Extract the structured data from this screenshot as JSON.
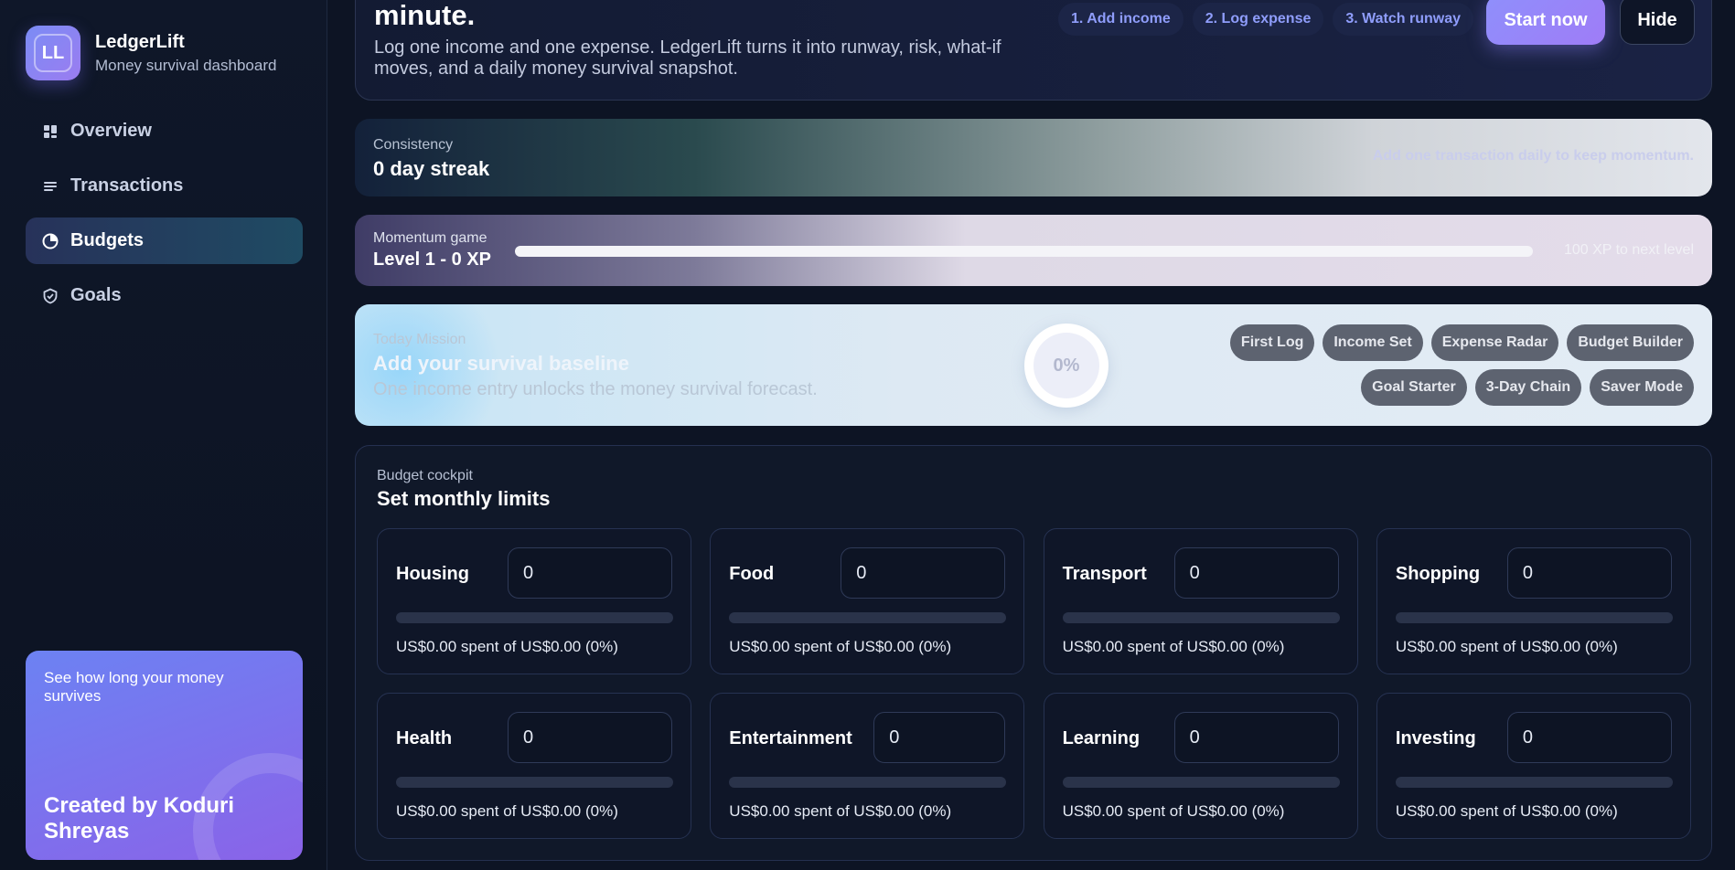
{
  "brand": {
    "logo_text": "LL",
    "name": "LedgerLift",
    "subtitle": "Money survival dashboard"
  },
  "nav": {
    "items": [
      {
        "label": "Overview",
        "icon": "grid-icon",
        "active": false
      },
      {
        "label": "Transactions",
        "icon": "list-icon",
        "active": false
      },
      {
        "label": "Budgets",
        "icon": "pie-icon",
        "active": true
      },
      {
        "label": "Goals",
        "icon": "shield-check-icon",
        "active": false
      }
    ]
  },
  "promo": {
    "tagline": "See how long your money survives",
    "credit": "Created by Koduri Shreyas"
  },
  "hero": {
    "title": "minute.",
    "description": "Log one income and one expense. LedgerLift turns it into runway, risk, what-if moves, and a daily money survival snapshot.",
    "steps": [
      "1. Add income",
      "2. Log expense",
      "3. Watch runway"
    ],
    "start_label": "Start now",
    "hide_label": "Hide"
  },
  "streak": {
    "label": "Consistency",
    "value": "0 day streak",
    "hint": "Add one transaction daily to keep momentum."
  },
  "momentum": {
    "label": "Momentum game",
    "value": "Level 1 - 0 XP",
    "progress": 0,
    "hint": "100 XP to next level"
  },
  "mission": {
    "label": "Today Mission",
    "title": "Add your survival baseline",
    "subtitle": "One income entry unlocks the money survival forecast.",
    "progress_label": "0%",
    "badges": [
      "First Log",
      "Income Set",
      "Expense Radar",
      "Budget Builder",
      "Goal Starter",
      "3-Day Chain",
      "Saver Mode"
    ]
  },
  "cockpit": {
    "label": "Budget cockpit",
    "title": "Set monthly limits",
    "categories": [
      {
        "name": "Housing",
        "value": "0",
        "spent_pct": 0,
        "status": "US$0.00 spent of US$0.00 (0%)"
      },
      {
        "name": "Food",
        "value": "0",
        "spent_pct": 0,
        "status": "US$0.00 spent of US$0.00 (0%)"
      },
      {
        "name": "Transport",
        "value": "0",
        "spent_pct": 0,
        "status": "US$0.00 spent of US$0.00 (0%)"
      },
      {
        "name": "Shopping",
        "value": "0",
        "spent_pct": 0,
        "status": "US$0.00 spent of US$0.00 (0%)"
      },
      {
        "name": "Health",
        "value": "0",
        "spent_pct": 0,
        "status": "US$0.00 spent of US$0.00 (0%)"
      },
      {
        "name": "Entertainment",
        "value": "0",
        "spent_pct": 0,
        "status": "US$0.00 spent of US$0.00 (0%)"
      },
      {
        "name": "Learning",
        "value": "0",
        "spent_pct": 0,
        "status": "US$0.00 spent of US$0.00 (0%)"
      },
      {
        "name": "Investing",
        "value": "0",
        "spent_pct": 0,
        "status": "US$0.00 spent of US$0.00 (0%)"
      }
    ]
  },
  "colors": {
    "accent": "#8c9cf8",
    "active_nav_start": "#27325a",
    "active_nav_end": "#1f4b63",
    "promo_start": "#6c82f3",
    "promo_end": "#8a63e8"
  }
}
